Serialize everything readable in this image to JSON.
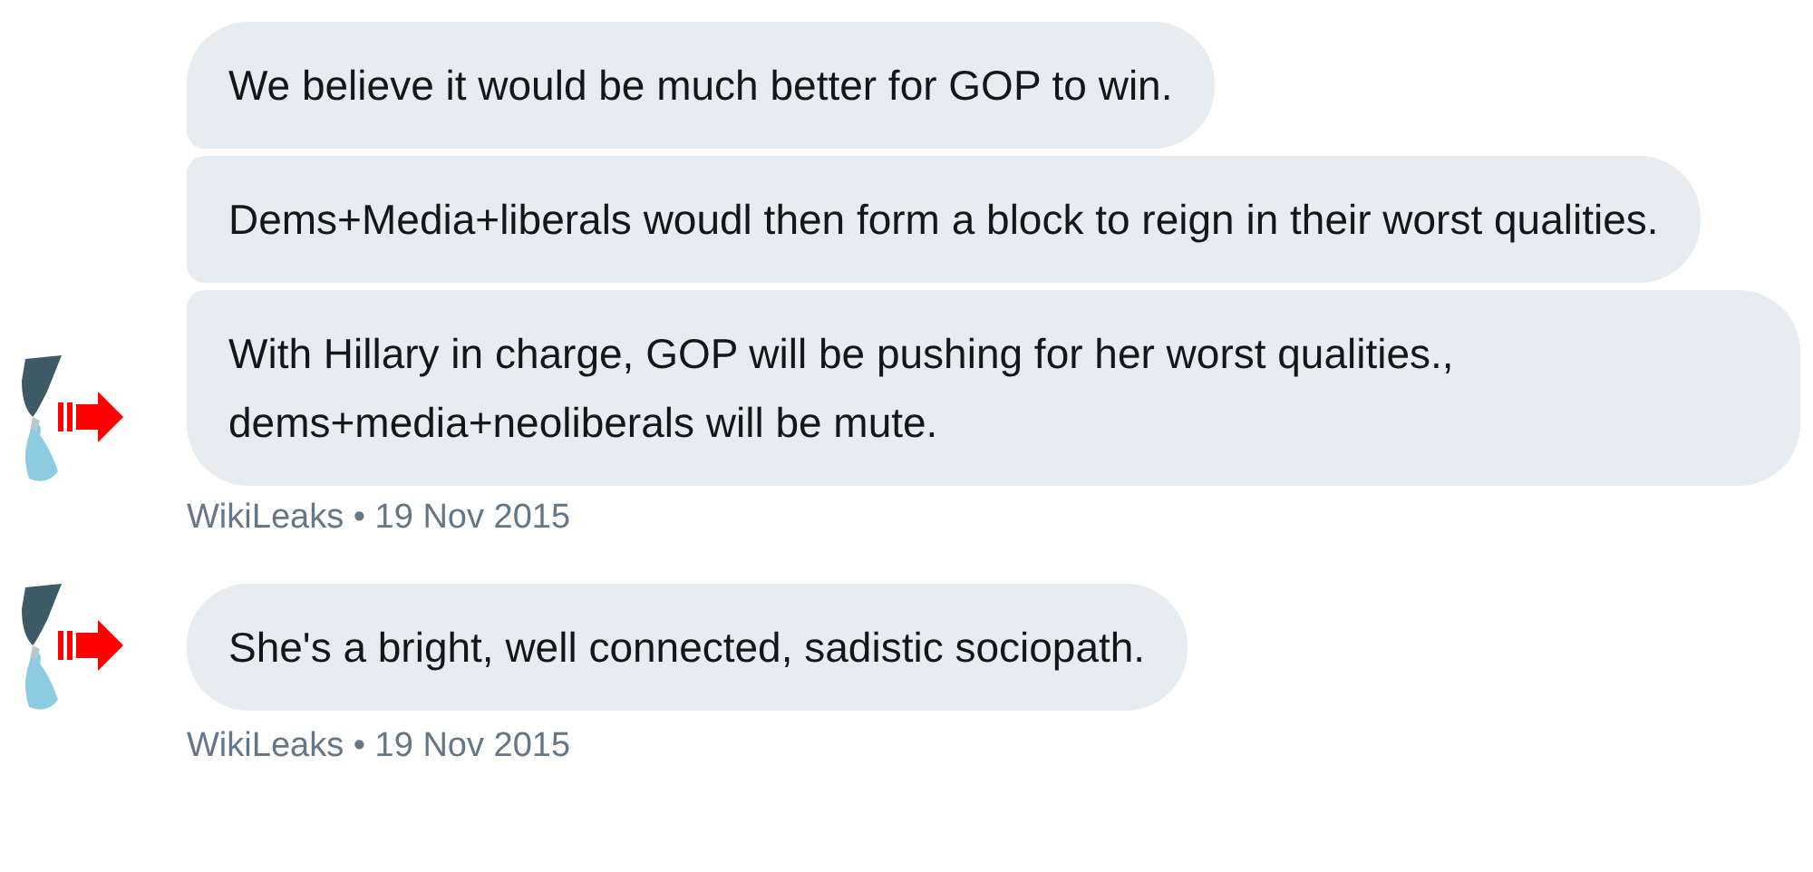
{
  "conversation": [
    {
      "messages": [
        "We believe it would be much better for GOP to win.",
        "Dems+Media+liberals woudl then form a block to reign in their worst qualities.",
        "With Hillary in charge, GOP will be pushing for her worst qualities., dems+media+neoliberals will be mute."
      ],
      "sender": "WikiLeaks",
      "separator": "•",
      "date": "19 Nov 2015"
    },
    {
      "messages": [
        "She's a bright, well connected, sadistic sociopath."
      ],
      "sender": "WikiLeaks",
      "separator": "•",
      "date": "19 Nov 2015"
    }
  ]
}
